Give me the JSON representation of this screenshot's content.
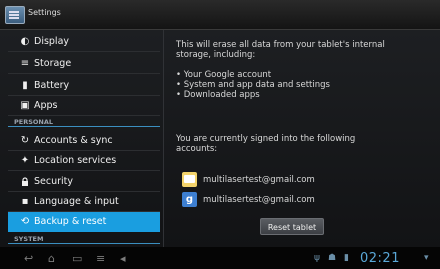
{
  "app": {
    "title": "Settings",
    "icon": "settings-app-icon"
  },
  "sidebar": {
    "items": [
      {
        "label": "Display",
        "icon": "display-icon",
        "glyph": "◐"
      },
      {
        "label": "Storage",
        "icon": "storage-icon",
        "glyph": "≡"
      },
      {
        "label": "Battery",
        "icon": "battery-icon",
        "glyph": "▮"
      },
      {
        "label": "Apps",
        "icon": "apps-icon",
        "glyph": "▣"
      },
      {
        "label": "Accounts & sync",
        "icon": "sync-icon",
        "glyph": "↻"
      },
      {
        "label": "Location services",
        "icon": "location-icon",
        "glyph": "✦"
      },
      {
        "label": "Security",
        "icon": "lock-icon",
        "glyph": "🔒"
      },
      {
        "label": "Language & input",
        "icon": "language-icon",
        "glyph": "▪"
      },
      {
        "label": "Backup & reset",
        "icon": "backup-icon",
        "glyph": "⟲",
        "active": true
      }
    ],
    "sections": {
      "personal": "PERSONAL",
      "system": "SYSTEM"
    }
  },
  "detail": {
    "intro_1": "This will erase all data from your tablet's internal",
    "intro_2": "storage, including:",
    "bullets": [
      "Your Google account",
      "System and app data and settings",
      "Downloaded apps"
    ],
    "signed_in_1": "You are currently signed into the following",
    "signed_in_2": "accounts:",
    "accounts": [
      {
        "email": "multilasertest@gmail.com",
        "icon": "mail-icon"
      },
      {
        "email": "multilasertest@gmail.com",
        "icon": "google-plus-icon",
        "glyph": "g"
      }
    ],
    "reset_button": "Reset tablet"
  },
  "systembar": {
    "nav": {
      "back": "↩",
      "home": "⌂",
      "recent": "▭",
      "menu": "≡",
      "volume": "◂"
    },
    "status_icons": [
      "usb-icon",
      "android-icon",
      "battery-status-icon"
    ],
    "clock": "02:21"
  },
  "colors": {
    "accent": "#1a9ee0",
    "background": "#151618"
  }
}
